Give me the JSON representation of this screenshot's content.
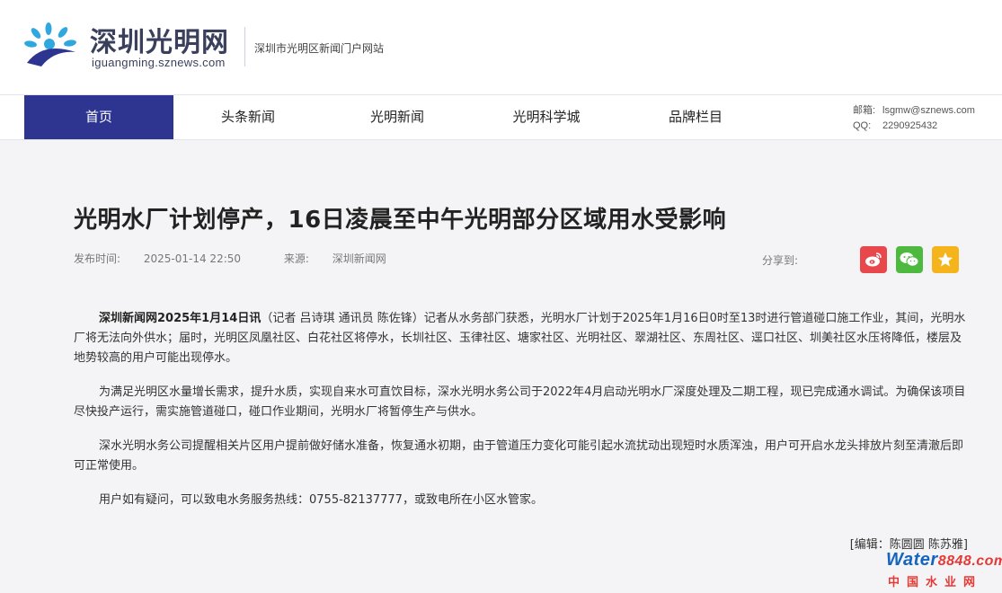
{
  "header": {
    "logo_cn": "深圳光明网",
    "logo_en": "iguangming.sznews.com",
    "tagline": "深圳市光明区新闻门户网站"
  },
  "nav": {
    "items": [
      {
        "label": "首页",
        "active": true
      },
      {
        "label": "头条新闻",
        "active": false
      },
      {
        "label": "光明新闻",
        "active": false
      },
      {
        "label": "光明科学城",
        "active": false
      },
      {
        "label": "品牌栏目",
        "active": false
      }
    ],
    "contact": {
      "email_label": "邮箱:",
      "email": "lsgmw@sznews.com",
      "qq_label": "QQ:",
      "qq": "2290925432"
    }
  },
  "article": {
    "title": "光明水厂计划停产，16日凌晨至中午光明部分区域用水受影响",
    "publish_label": "发布时间:",
    "publish_time": "2025-01-14 22:50",
    "source_label": "来源:",
    "source": "深圳新闻网",
    "share_label": "分享到:",
    "p1_lead": "深圳新闻网2025年1月14日讯",
    "p1_rest": "（记者 吕诗琪 通讯员 陈佐锋）记者从水务部门获悉，光明水厂计划于2025年1月16日0时至13时进行管道碰口施工作业，其间，光明水厂将无法向外供水；届时，光明区凤凰社区、白花社区将停水，长圳社区、玉律社区、塘家社区、光明社区、翠湖社区、东周社区、逕口社区、圳美社区水压将降低，楼层及地势较高的用户可能出现停水。",
    "p2": "为满足光明区水量增长需求，提升水质，实现自来水可直饮目标，深水光明水务公司于2022年4月启动光明水厂深度处理及二期工程，现已完成通水调试。为确保该项目尽快投产运行，需实施管道碰口，碰口作业期间，光明水厂将暂停生产与供水。",
    "p3": "深水光明水务公司提醒相关片区用户提前做好储水准备，恢复通水初期，由于管道压力变化可能引起水流扰动出现短时水质浑浊，用户可开启水龙头排放片刻至清澈后即可正常使用。",
    "p4": "用户如有疑问，可以致电水务服务热线：0755-82137777，或致电所在小区水管家。",
    "editor": "[编辑：陈圆圆 陈苏雅]"
  },
  "watermark": {
    "top_a": "Water",
    "top_b": "8848.com",
    "bottom": "中国水业网"
  },
  "colors": {
    "nav_active": "#2d3590",
    "weibo": "#e8474c",
    "wechat": "#4dba3f",
    "qzone": "#f5b41b"
  },
  "icons": [
    "sunburst-logo-icon",
    "weibo-icon",
    "wechat-icon",
    "qzone-star-icon"
  ]
}
